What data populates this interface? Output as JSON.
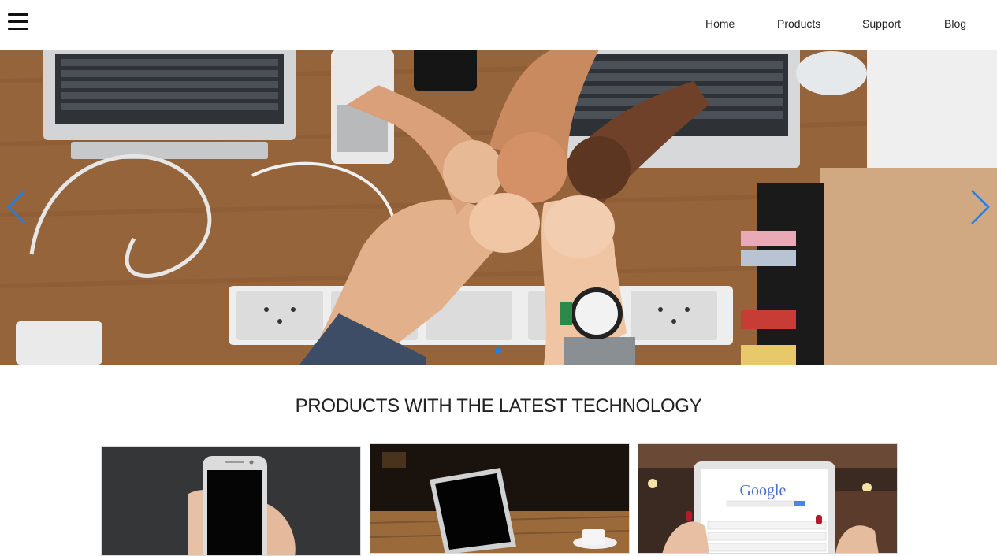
{
  "header": {
    "menu_icon": "hamburger-menu-icon",
    "nav": [
      {
        "label": "Home"
      },
      {
        "label": "Products"
      },
      {
        "label": "Support"
      },
      {
        "label": "Blog"
      }
    ]
  },
  "hero": {
    "image_description_icon": "photo-team-fist-bump",
    "prev_icon": "chevron-left-icon",
    "next_icon": "chevron-right-icon",
    "active_slide": 1,
    "slide_count": 1,
    "accent_color": "#1e7fe8"
  },
  "products": {
    "title": "PRODUCTS WITH THE LATEST TECHNOLOGY",
    "cards": [
      {
        "image": "smartphone-in-hand-photo"
      },
      {
        "image": "laptop-on-table-photo"
      },
      {
        "image": "tablet-with-search-page-photo",
        "screen_logo": "Google"
      }
    ]
  }
}
